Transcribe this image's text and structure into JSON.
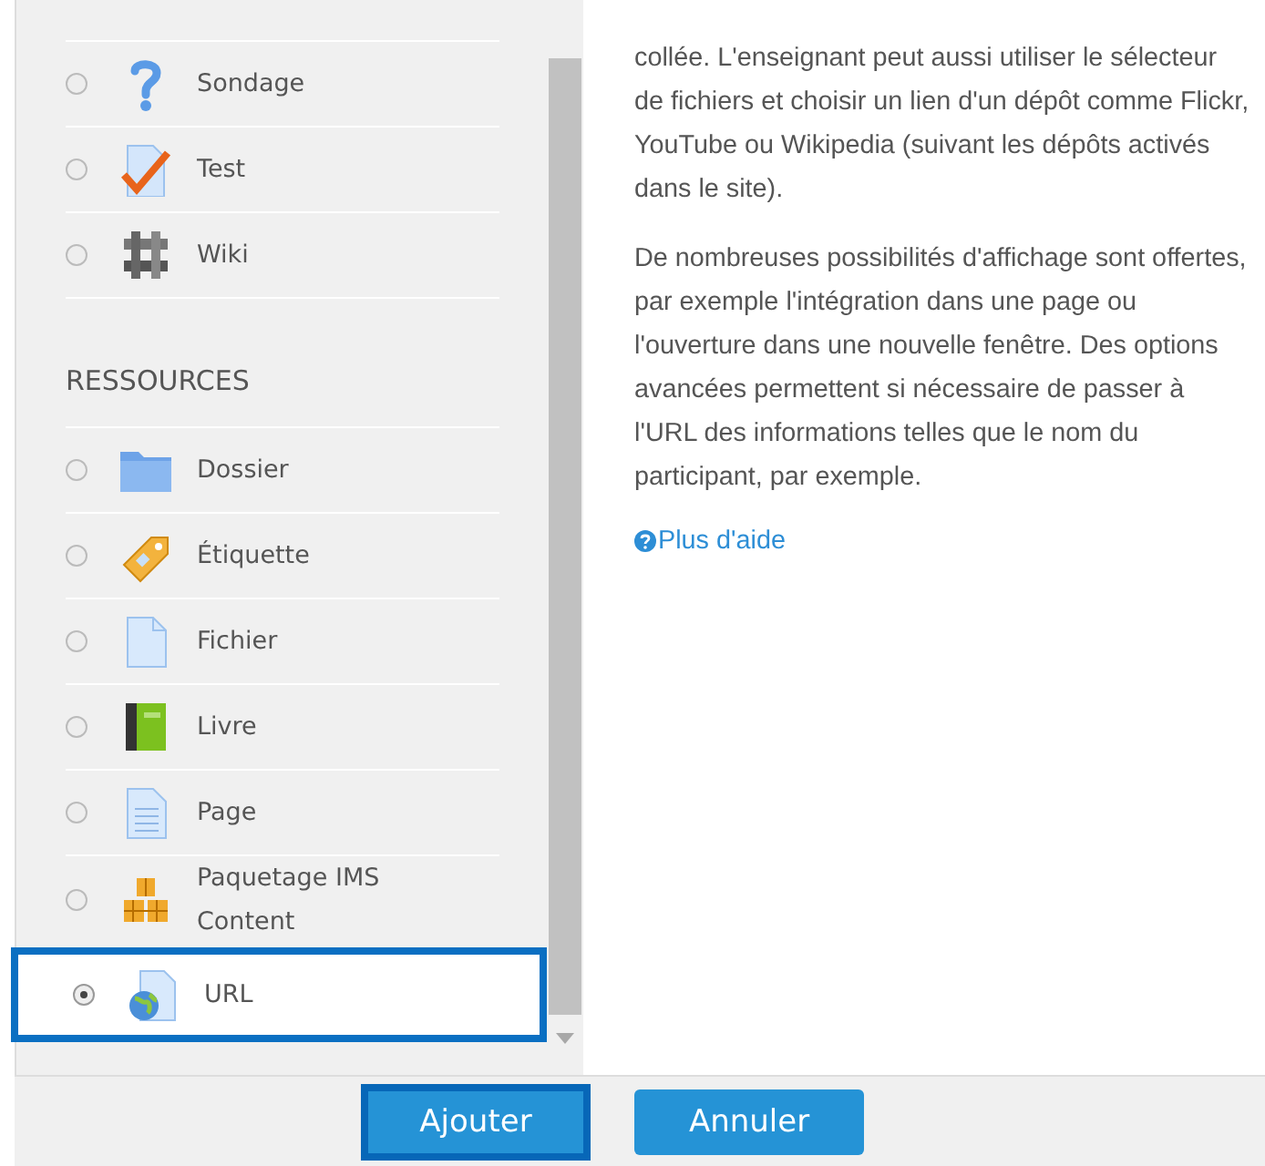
{
  "activities": [
    {
      "kind": "survey",
      "label": "Sondage",
      "selected": false
    },
    {
      "kind": "quiz",
      "label": "Test",
      "selected": false
    },
    {
      "kind": "wiki",
      "label": "Wiki",
      "selected": false
    }
  ],
  "resources": {
    "heading": "RESSOURCES",
    "items": [
      {
        "kind": "folder",
        "label": "Dossier",
        "selected": false
      },
      {
        "kind": "label",
        "label": "Étiquette",
        "selected": false
      },
      {
        "kind": "file",
        "label": "Fichier",
        "selected": false
      },
      {
        "kind": "book",
        "label": "Livre",
        "selected": false
      },
      {
        "kind": "page",
        "label": "Page",
        "selected": false
      },
      {
        "kind": "package",
        "label": "Paquetage IMS Content",
        "selected": false
      },
      {
        "kind": "url",
        "label": "URL",
        "selected": true
      }
    ]
  },
  "help": {
    "paragraphs": [
      "collée. L'enseignant peut aussi utiliser le sélecteur de fichiers et choisir un lien d'un dépôt comme Flickr, YouTube ou Wikipedia (suivant les dépôts activés dans le site).",
      "De nombreuses possibilités d'affichage sont offertes, par exemple l'intégration dans une page ou l'ouverture dans une nouvelle fenêtre. Des options avancées permettent si nécessaire de passer à l'URL des informations telles que le nom du participant, par exemple."
    ],
    "link": "Plus d'aide"
  },
  "buttons": [
    {
      "label": "Ajouter",
      "focused": true
    },
    {
      "label": "Annuler",
      "focused": false
    }
  ]
}
